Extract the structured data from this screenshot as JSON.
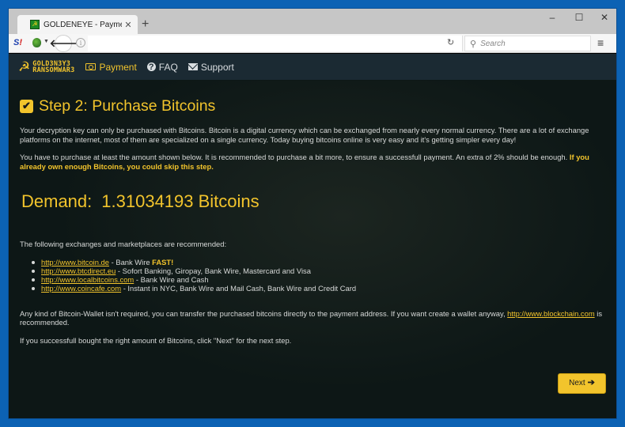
{
  "browser": {
    "tab_title": "GOLDENEYE - Payment (St...",
    "tab_close": "✕",
    "new_tab": "+",
    "window_controls": {
      "minimize": "–",
      "maximize": "☐",
      "close": "✕"
    },
    "toolbar": {
      "addon_s": "S",
      "addon_s_mark": "!",
      "back": "🡐",
      "info": "i",
      "reload": "↻",
      "search_placeholder": "Search",
      "search_icon": "⚲",
      "menu": "≡"
    }
  },
  "site": {
    "logo": {
      "icon": "☭",
      "line1": "GOLD3N3Y3",
      "line2": "RANSOMWAR3"
    },
    "nav": [
      {
        "label": "Payment",
        "icon": "money-icon",
        "active": true
      },
      {
        "label": "FAQ",
        "icon": "question-icon",
        "glyph": "?"
      },
      {
        "label": "Support",
        "icon": "envelope-icon"
      }
    ]
  },
  "page": {
    "step_check": "✔",
    "step_title": "Step 2: Purchase Bitcoins",
    "intro": "Your decryption key can only be purchased with Bitcoins. Bitcoin is a digital currency which can be exchanged from nearly every normal currency. There are a lot of exchange platforms on the internet, most of them are specialized on a single currency. Today buying bitcoins online is very easy and it's getting simpler every day!",
    "purchase_note": "You have to purchase at least the amount shown below. It is recommended to purchase a bit more, to ensure a successfull payment. An extra of 2% should be enough. ",
    "purchase_note_highlight": "If you already own enough Bitcoins, you could skip this step.",
    "demand_label": "Demand:",
    "demand_amount": "1.31034193 Bitcoins",
    "exchanges_intro": "The following exchanges and marketplaces are recommended:",
    "exchanges": [
      {
        "url": "http://www.bitcoin.de",
        "desc": " - Bank Wire ",
        "badge": "FAST!"
      },
      {
        "url": "http://www.btcdirect.eu",
        "desc": " - Sofort Banking, Giropay, Bank Wire, Mastercard and Visa",
        "badge": ""
      },
      {
        "url": "http://www.localbitcoins.com",
        "desc": " - Bank Wire and Cash",
        "badge": ""
      },
      {
        "url": "http://www.coincafe.com",
        "desc": " - Instant in NYC, Bank Wire and Mail Cash, Bank Wire and Credit Card",
        "badge": ""
      }
    ],
    "wallet_note": "Any kind of Bitcoin-Wallet isn't required, you can transfer the purchased bitcoins directly to the payment address. If you want create a wallet anyway, ",
    "wallet_link": "http://www.blockchain.com",
    "wallet_note_end": " is recommended.",
    "next_note": "If you successfull bought the right amount of Bitcoins, click \"Next\" for the next step.",
    "next_label": "Next",
    "next_arrow": "➔"
  },
  "colors": {
    "accent": "#f2c42c",
    "background": "#0d1716",
    "navbar": "#1b2a33",
    "desktop": "#0c62b4"
  }
}
